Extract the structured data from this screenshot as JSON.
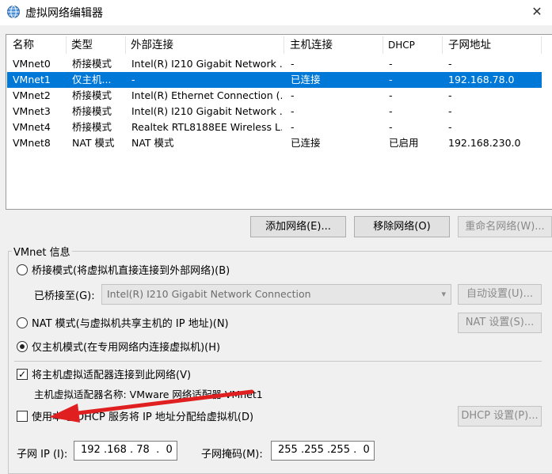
{
  "window": {
    "title": "虚拟网络编辑器",
    "close_glyph": "✕"
  },
  "table": {
    "columns": [
      "名称",
      "类型",
      "外部连接",
      "主机连接",
      "DHCP",
      "子网地址"
    ],
    "rows": [
      [
        "VMnet0",
        "桥接模式",
        "Intel(R) I210 Gigabit Network ...",
        "-",
        "-",
        "-"
      ],
      [
        "VMnet1",
        "仅主机...",
        "-",
        "已连接",
        "-",
        "192.168.78.0"
      ],
      [
        "VMnet2",
        "桥接模式",
        "Intel(R) Ethernet Connection (...",
        "-",
        "-",
        "-"
      ],
      [
        "VMnet3",
        "桥接模式",
        "Intel(R) I210 Gigabit Network ...",
        "-",
        "-",
        "-"
      ],
      [
        "VMnet4",
        "桥接模式",
        "Realtek RTL8188EE Wireless L...",
        "-",
        "-",
        "-"
      ],
      [
        "VMnet8",
        "NAT 模式",
        "NAT 模式",
        "已连接",
        "已启用",
        "192.168.230.0"
      ]
    ],
    "selected_row": "VMnet1"
  },
  "buttons": {
    "add_network": "添加网络(E)...",
    "remove_network": "移除网络(O)",
    "rename_network": "重命名网络(W)..."
  },
  "vmnet_info": {
    "title": "VMnet 信息",
    "bridged_label": "桥接模式(将虚拟机直接连接到外部网络)(B)",
    "bridged_to_label": "已桥接至(G):",
    "bridged_to_value": "Intel(R) I210 Gigabit Network Connection",
    "auto_settings": "自动设置(U)...",
    "nat_label": "NAT 模式(与虚拟机共享主机的 IP 地址)(N)",
    "nat_settings": "NAT 设置(S)...",
    "hostonly_label": "仅主机模式(在专用网络内连接虚拟机)(H)",
    "selected_mode": "hostonly",
    "connect_adapter_label": "将主机虚拟适配器连接到此网络(V)",
    "connect_adapter_checked": true,
    "adapter_name_label": "主机虚拟适配器名称: VMware 网络适配器 VMnet1",
    "dhcp_label": "使用本地 DHCP 服务将 IP 地址分配给虚拟机(D)",
    "dhcp_checked": false,
    "dhcp_settings": "DHCP 设置(P)...",
    "subnet_ip_label": "子网 IP (I):",
    "subnet_ip_value": "192 .168 . 78  .  0",
    "subnet_mask_label": "子网掩码(M):",
    "subnet_mask_value": "255 .255 .255 .  0"
  },
  "colors": {
    "selection": "#0078d7",
    "annotation_arrow": "#e02020"
  },
  "icons": {
    "app": "network-globe-icon",
    "check": "✓",
    "combo": "▾"
  }
}
